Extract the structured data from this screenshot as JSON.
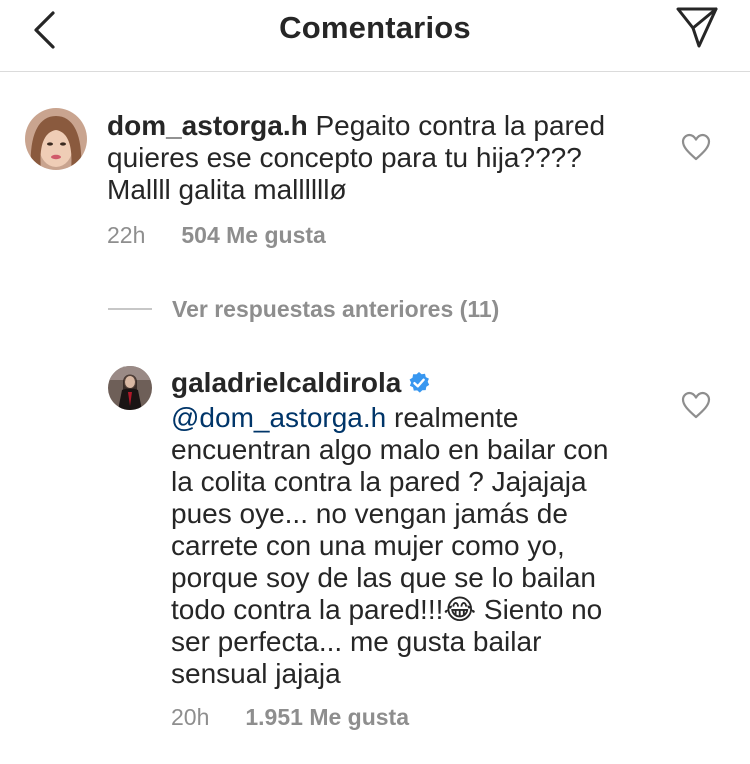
{
  "header": {
    "title": "Comentarios",
    "back_icon": "chevron-left-icon",
    "send_icon": "paper-plane-icon"
  },
  "comment1": {
    "username": "dom_astorga.h",
    "text_line1": " Pegaito contra la pared",
    "text_line2": "quieres ese concepto para tu hija????",
    "text_line3": "Mallll galita mallllllø",
    "time": "22h",
    "likes": "504 Me gusta"
  },
  "replies_toggle": {
    "label": "Ver respuestas anteriores (11)"
  },
  "reply": {
    "username": "galadrielcaldirola",
    "verified_color": "#3897f0",
    "mention": "@dom_astorga.h",
    "lines": [
      " realmente",
      "encuentran algo malo en bailar con",
      "la colita contra la pared ? Jajajaja",
      "pues oye... no vengan jamás de",
      "carrete con una mujer como yo,",
      "porque soy de las que se lo bailan",
      "todo contra la pared!!!",
      " Siento no",
      "ser perfecta... me gusta bailar",
      "sensual jajaja"
    ],
    "emoji": "😂",
    "time": "20h",
    "likes": "1.951 Me gusta"
  }
}
